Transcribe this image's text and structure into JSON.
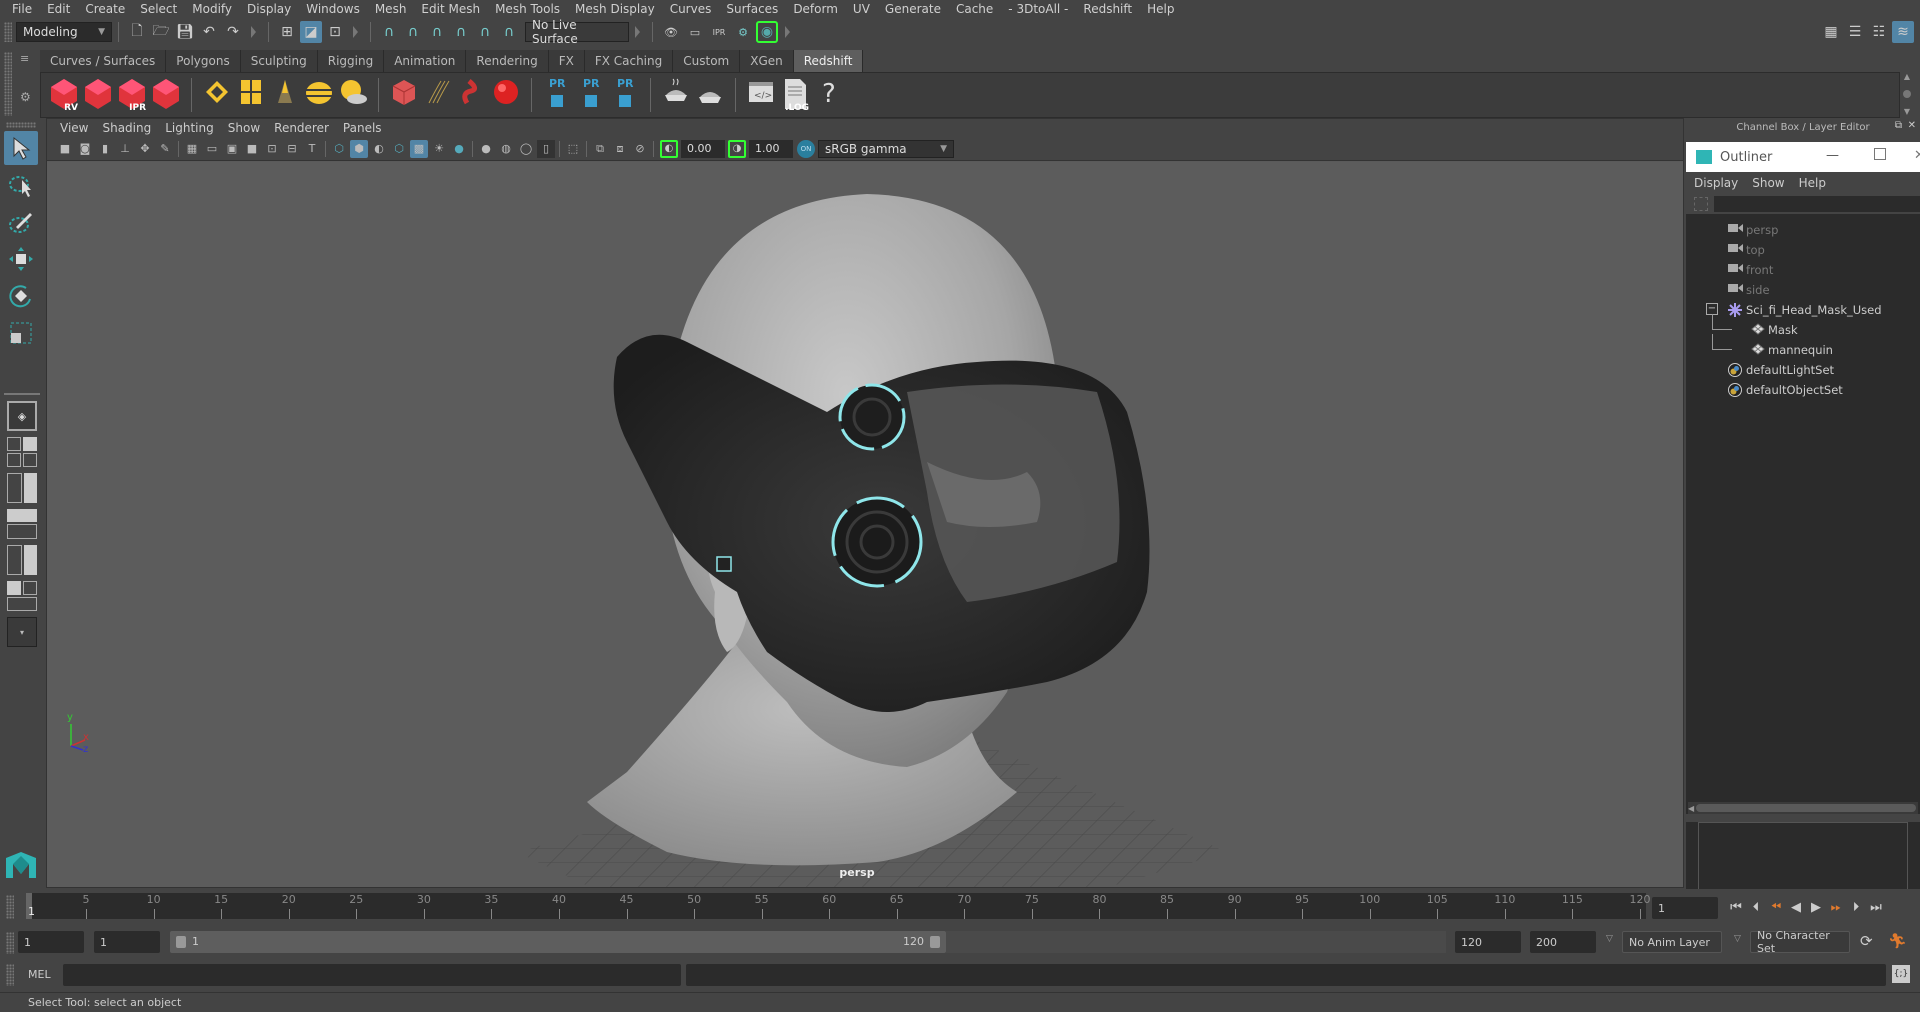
{
  "menubar": {
    "items": [
      "File",
      "Edit",
      "Create",
      "Select",
      "Modify",
      "Display",
      "Windows",
      "Mesh",
      "Edit Mesh",
      "Mesh Tools",
      "Mesh Display",
      "Curves",
      "Surfaces",
      "Deform",
      "UV",
      "Generate",
      "Cache",
      "- 3DtoAll -",
      "Redshift",
      "Help"
    ]
  },
  "statusline": {
    "workspace_mode": "Modeling",
    "live_surface": "No Live Surface",
    "icons": [
      "new-scene-icon",
      "open-scene-icon",
      "save-scene-icon",
      "undo-icon",
      "redo-icon",
      "select-by-hierarchy-icon",
      "select-by-object-icon",
      "select-by-component-icon",
      "snap-to-grid-icon",
      "snap-to-curve-icon",
      "snap-to-point-icon",
      "snap-to-projected-center-icon",
      "snap-to-view-plane-icon",
      "make-live-icon",
      "render-view-icon",
      "render-current-frame-icon",
      "ipr-render-icon",
      "render-settings-icon",
      "hypershade-icon"
    ],
    "right_icons": [
      "modeling-toolkit-icon",
      "attribute-editor-icon",
      "tool-settings-icon",
      "channel-box-layer-editor-icon"
    ]
  },
  "shelf": {
    "tabs": [
      "Curves / Surfaces",
      "Polygons",
      "Sculpting",
      "Rigging",
      "Animation",
      "Rendering",
      "FX",
      "FX Caching",
      "Custom",
      "XGen",
      "Redshift"
    ],
    "active_tab": "Redshift",
    "buttons": [
      {
        "name": "redshift-render-view",
        "label": "RV"
      },
      {
        "name": "redshift-render-sequence",
        "label": ""
      },
      {
        "name": "redshift-ipr",
        "label": "IPR"
      },
      {
        "name": "redshift-render-settings",
        "label": ""
      },
      {
        "name": "redshift-area-light",
        "label": ""
      },
      {
        "name": "redshift-portal-light",
        "label": ""
      },
      {
        "name": "redshift-ies-light",
        "label": ""
      },
      {
        "name": "redshift-dome-light",
        "label": ""
      },
      {
        "name": "redshift-sun-sky",
        "label": ""
      },
      {
        "name": "redshift-volume",
        "label": ""
      },
      {
        "name": "redshift-hair",
        "label": ""
      },
      {
        "name": "redshift-mesh-light",
        "label": ""
      },
      {
        "name": "redshift-material",
        "label": ""
      },
      {
        "name": "redshift-proxy-create",
        "label": "PR"
      },
      {
        "name": "redshift-proxy-export",
        "label": "PR"
      },
      {
        "name": "redshift-proxy-swap",
        "label": "PR"
      },
      {
        "name": "redshift-bake",
        "label": ""
      },
      {
        "name": "redshift-bake-set",
        "label": ""
      },
      {
        "name": "redshift-shader-editor",
        "label": ""
      },
      {
        "name": "redshift-log",
        "label": ".LOG"
      },
      {
        "name": "redshift-help",
        "label": "?"
      }
    ]
  },
  "viewport": {
    "menu": [
      "View",
      "Shading",
      "Lighting",
      "Show",
      "Renderer",
      "Panels"
    ],
    "exposure": "0.00",
    "gamma": "1.00",
    "color_space": "sRGB gamma",
    "camera_label": "persp",
    "axis_labels": {
      "x": "x",
      "y": "y",
      "z": "z"
    }
  },
  "right_panel": {
    "header": "Channel Box / Layer Editor",
    "outliner": {
      "title": "Outliner",
      "menu": [
        "Display",
        "Show",
        "Help"
      ],
      "items": [
        {
          "label": "persp",
          "type": "camera",
          "dim": true,
          "depth": 0
        },
        {
          "label": "top",
          "type": "camera",
          "dim": true,
          "depth": 0
        },
        {
          "label": "front",
          "type": "camera",
          "dim": true,
          "depth": 0
        },
        {
          "label": "side",
          "type": "camera",
          "dim": true,
          "depth": 0
        },
        {
          "label": "Sci_fi_Head_Mask_Used",
          "type": "group",
          "dim": false,
          "depth": 0,
          "expanded": true
        },
        {
          "label": "Mask",
          "type": "mesh",
          "dim": false,
          "depth": 1
        },
        {
          "label": "mannequin",
          "type": "mesh",
          "dim": false,
          "depth": 1
        },
        {
          "label": "defaultLightSet",
          "type": "set",
          "dim": false,
          "depth": 0
        },
        {
          "label": "defaultObjectSet",
          "type": "set",
          "dim": false,
          "depth": 0
        }
      ]
    }
  },
  "timeline": {
    "ticks": [
      5,
      10,
      15,
      20,
      25,
      30,
      35,
      40,
      45,
      50,
      55,
      60,
      65,
      70,
      75,
      80,
      85,
      90,
      95,
      100,
      105,
      110,
      115,
      120
    ],
    "current_frame_marker": "1",
    "current_frame": "1",
    "range_min": 1,
    "range_max": 120
  },
  "range": {
    "start_time": "1",
    "playback_start": "1",
    "slider_start": "1",
    "slider_end": "120",
    "playback_end": "120",
    "end_time": "200",
    "anim_layer": "No Anim Layer",
    "character_set": "No Character Set"
  },
  "command_line": {
    "language": "MEL",
    "value": ""
  },
  "help_line": {
    "text": "Select Tool: select an object"
  },
  "colors": {
    "accent_blue": "#5285a6",
    "maya_teal": "#2fb5b5",
    "redshift_red": "#e0343c",
    "light_yellow": "#f4c430",
    "snap_green": "#33ff33",
    "playback_orange": "#e07a2e"
  }
}
